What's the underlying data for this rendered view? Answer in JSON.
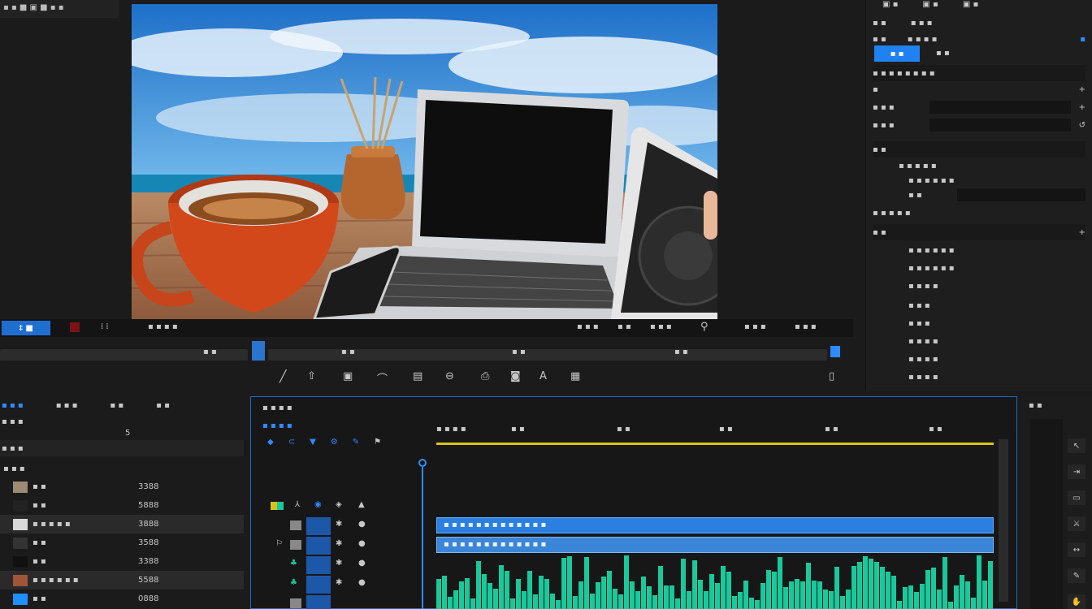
{
  "top_strip": {
    "text": "▪ ▪ ■ ▣ ■ ▪ ▪"
  },
  "monitor": {
    "fit_label": "‡ ■",
    "timecode_left": "⁞ ⁞",
    "zoom_label": "▪ ▪ ▪ ▪",
    "right_labels": [
      "▪ ▪ ▪",
      "▪ ▪",
      "▪ ▪ ▪",
      "▪ ▪ ▪",
      "▪ ▪ ▪"
    ],
    "ruler_labels": [
      "▪ ▪",
      "▪ ▪",
      "▪ ▪",
      "▪ ▪"
    ],
    "tools": [
      "pen",
      "lift",
      "extract",
      "export-frame",
      "insert",
      "overwrite",
      "camera",
      "compare",
      "text",
      "settings"
    ]
  },
  "right_panel": {
    "tabs": [
      "▣ ▪",
      "▣ ▪",
      "▣ ▪"
    ],
    "row1": [
      "▪ ▪",
      "▪ ▪ ▪"
    ],
    "row2": [
      "▪ ▪",
      "▪ ▪ ▪ ▪",
      "▪"
    ],
    "active_tab": "▪ ▪",
    "second_tab": "▪ ▪",
    "section1": "▪ ▪ ▪ ▪ ▪ ▪ ▪ ▪",
    "fields": [
      {
        "label": "▪",
        "value": ""
      },
      {
        "label": "▪ ▪ ▪",
        "value": ""
      },
      {
        "label": "▪ ▪ ▪",
        "value": ""
      }
    ],
    "section2": "▪ ▪",
    "sub1": "▪ ▪ ▪ ▪ ▪",
    "sub2": "▪ ▪ ▪ ▪ ▪ ▪",
    "sub3": "▪ ▪",
    "section3": "▪ ▪ ▪ ▪ ▪",
    "section4": "▪ ▪",
    "list": [
      "▪ ▪ ▪ ▪ ▪ ▪",
      "▪ ▪ ▪ ▪ ▪ ▪",
      "▪ ▪ ▪ ▪",
      "▪ ▪ ▪",
      "▪ ▪ ▪",
      "▪ ▪ ▪ ▪",
      "▪ ▪ ▪ ▪",
      "▪ ▪ ▪ ▪"
    ]
  },
  "project": {
    "tabs": [
      "▪ ▪ ▪",
      "▪ ▪ ▪",
      "▪ ▪",
      "▪ ▪"
    ],
    "subtitle": "▪ ▪ ▪",
    "count": "5",
    "title": "▪ ▪ ▪",
    "col_name": "▪ ▪ ▪",
    "rows": [
      {
        "name": "▪ ▪",
        "dur": "3388",
        "thumb": "#9c8a74"
      },
      {
        "name": "▪ ▪",
        "dur": "5888",
        "thumb": "#222222"
      },
      {
        "name": "▪ ▪ ▪ ▪ ▪",
        "dur": "3888",
        "thumb": "#d8d8d8"
      },
      {
        "name": "▪ ▪",
        "dur": "3588",
        "thumb": "#333333"
      },
      {
        "name": "▪ ▪",
        "dur": "3388",
        "thumb": "#111111"
      },
      {
        "name": "▪ ▪ ▪ ▪ ▪ ▪",
        "dur": "5588",
        "thumb": "#a0553a"
      },
      {
        "name": "▪ ▪",
        "dur": "0888",
        "thumb": "#1f8fff"
      }
    ]
  },
  "timeline": {
    "title": "▪ ▪ ▪ ▪",
    "timecode": "▪ ▪ ▪ ▪",
    "ruler_labels": [
      "▪ ▪ ▪ ▪",
      "▪ ▪",
      "▪ ▪",
      "▪ ▪",
      "▪ ▪",
      "▪ ▪"
    ],
    "clip_label": "▪ ▪ ▪ ▪ ▪ ▪ ▪ ▪ ▪ ▪ ▪ ▪ ▪",
    "audio_label": "▪ ▪ ▪ ▪ ▪ ▪ ▪ ▪ ▪ ▪ ▪ ▪ ▪"
  },
  "right_tools": {
    "title": "▪ ▪"
  },
  "colors": {
    "accent": "#2f8cff",
    "audio": "#19c99b",
    "clip": "#2a7fe0"
  }
}
